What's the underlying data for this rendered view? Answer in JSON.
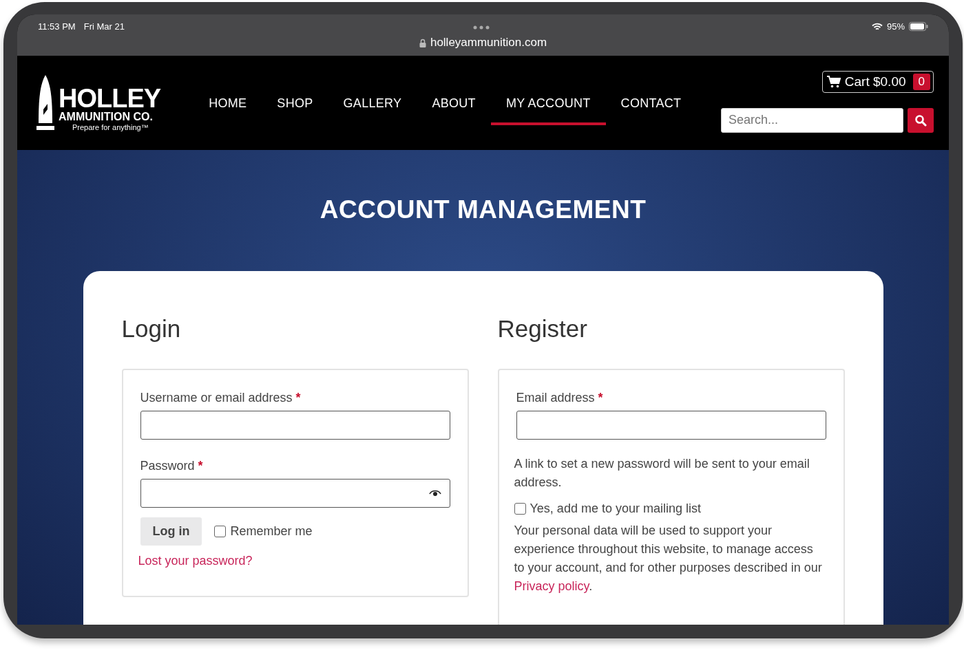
{
  "status_bar": {
    "time": "11:53 PM",
    "date": "Fri Mar 21",
    "battery": "95%"
  },
  "address_bar": {
    "url": "holleyammunition.com"
  },
  "logo": {
    "name": "HOLLEY",
    "subtitle": "AMMUNITION CO.",
    "tagline": "Prepare for anything™"
  },
  "nav": [
    {
      "label": "HOME",
      "selected": false
    },
    {
      "label": "SHOP",
      "selected": false
    },
    {
      "label": "GALLERY",
      "selected": false
    },
    {
      "label": "ABOUT",
      "selected": false
    },
    {
      "label": "MY ACCOUNT",
      "selected": true
    },
    {
      "label": "CONTACT",
      "selected": false
    }
  ],
  "cart": {
    "label": "Cart $0.00",
    "count": "0"
  },
  "search": {
    "placeholder": "Search..."
  },
  "hero": {
    "title": "ACCOUNT MANAGEMENT"
  },
  "login": {
    "heading": "Login",
    "username_label": "Username or email address",
    "password_label": "Password",
    "required_mark": "*",
    "button": "Log in",
    "remember_me": {
      "label": "Remember me",
      "checked": false
    },
    "lost_password": "Lost your password?"
  },
  "register": {
    "heading": "Register",
    "email_label": "Email address",
    "required_mark": "*",
    "note": "A link to set a new password will be sent to your email address.",
    "mailing_list": {
      "label": "Yes, add me to your mailing list",
      "checked": false
    },
    "privacy_text": "Your personal data will be used to support your experience throughout this website, to manage access to your account, and for other purposes described in our",
    "privacy_link": "Privacy policy",
    "privacy_end": "."
  }
}
